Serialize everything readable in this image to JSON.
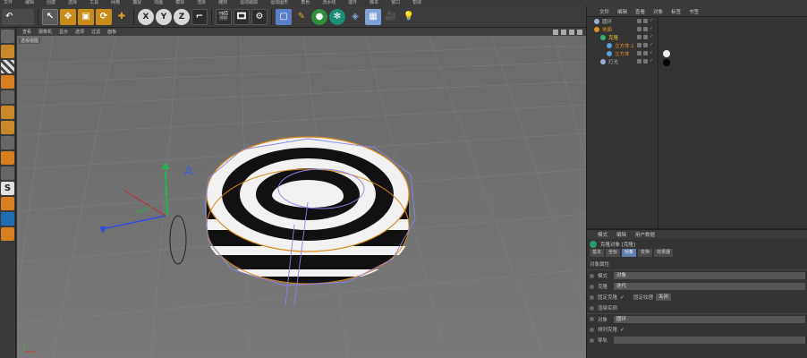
{
  "menubar": [
    "文件",
    "编辑",
    "创建",
    "选择",
    "工具",
    "网格",
    "捕捉",
    "动画",
    "模拟",
    "渲染",
    "雕刻",
    "运动跟踪",
    "运动图形",
    "角色",
    "流水线",
    "插件",
    "脚本",
    "窗口",
    "帮助"
  ],
  "toolbar": {
    "axis_x": "X",
    "axis_y": "Y",
    "axis_z": "Z"
  },
  "viewport": {
    "menu": [
      "查看",
      "摄像机",
      "显示",
      "选项",
      "过滤",
      "面板"
    ],
    "label": "透视视图"
  },
  "object_manager": {
    "menu": [
      "文件",
      "编辑",
      "查看",
      "对象",
      "标签",
      "书签"
    ],
    "objects": [
      {
        "name": "圆环",
        "color": "#9ab0d8",
        "style": "normal",
        "indent": 0
      },
      {
        "name": "地面",
        "color": "#e08e24",
        "style": "orange",
        "indent": 0
      },
      {
        "name": "克隆",
        "color": "#3ab07a",
        "style": "sel",
        "indent": 1
      },
      {
        "name": "立方体.1",
        "color": "#5aa0e0",
        "style": "orange",
        "indent": 2
      },
      {
        "name": "立方体",
        "color": "#5aa0e0",
        "style": "orange",
        "indent": 2
      },
      {
        "name": "灯光",
        "color": "#9ab0d8",
        "style": "normal",
        "indent": 1
      }
    ]
  },
  "attribute_manager": {
    "menu": [
      "模式",
      "编辑",
      "用户数据"
    ],
    "title": "克隆对象 [克隆]",
    "tabs": [
      "基本",
      "坐标",
      "对象",
      "变换",
      "效果器"
    ],
    "active_tab": "对象",
    "section": "对象属性",
    "rows": {
      "mode_label": "模式",
      "mode_value": "对象",
      "clones_label": "克隆",
      "clones_value": "迭代",
      "fix_clone_label": "固定克隆",
      "fix_texture_label": "固定纹理",
      "fix_texture_value": "关闭",
      "render_instances_label": "渲染实例",
      "object_label": "对象",
      "object_value": "圆环",
      "arrange_label": "排列克隆",
      "guide_label": "导轨"
    }
  }
}
